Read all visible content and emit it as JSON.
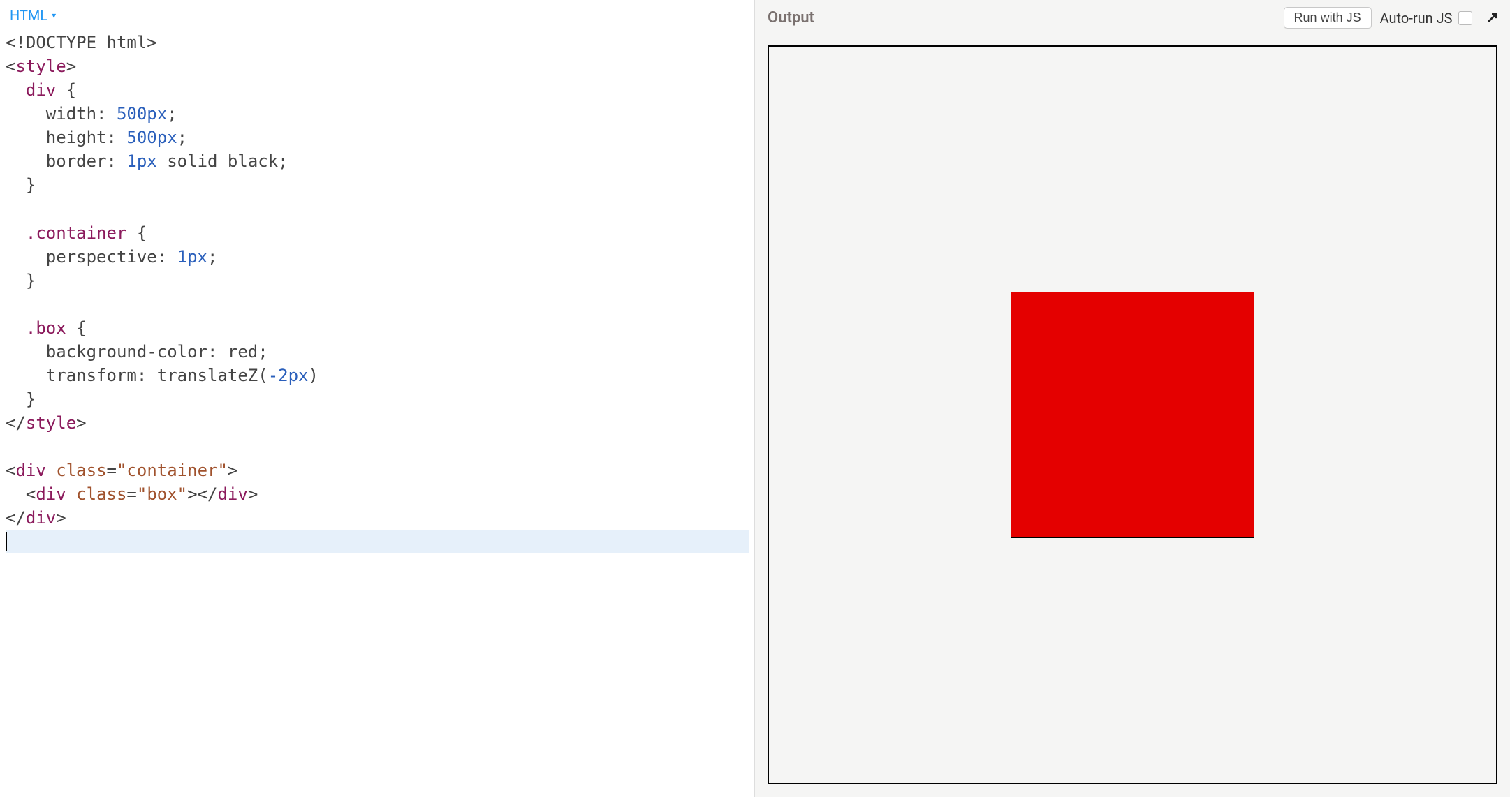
{
  "editor": {
    "language_label": "HTML",
    "code_lines": [
      {
        "html": "<span class='t-punct'>&lt;!</span><span class='t-doctype'>DOCTYPE html</span><span class='t-punct'>&gt;</span>"
      },
      {
        "html": "<span class='t-punct'>&lt;</span><span class='t-tag'>style</span><span class='t-punct'>&gt;</span>"
      },
      {
        "html": "  <span class='t-selector'>div</span> <span class='t-punct'>{</span>"
      },
      {
        "html": "    <span class='t-prop'>width</span><span class='t-punct'>:</span> <span class='t-num'>500px</span><span class='t-punct'>;</span>"
      },
      {
        "html": "    <span class='t-prop'>height</span><span class='t-punct'>:</span> <span class='t-num'>500px</span><span class='t-punct'>;</span>"
      },
      {
        "html": "    <span class='t-prop'>border</span><span class='t-punct'>:</span> <span class='t-num'>1px</span> <span class='t-kw'>solid</span> <span class='t-kw'>black</span><span class='t-punct'>;</span>"
      },
      {
        "html": "  <span class='t-punct'>}</span>"
      },
      {
        "html": ""
      },
      {
        "html": "  <span class='t-selector'>.container</span> <span class='t-punct'>{</span>"
      },
      {
        "html": "    <span class='t-prop'>perspective</span><span class='t-punct'>:</span> <span class='t-num'>1px</span><span class='t-punct'>;</span>"
      },
      {
        "html": "  <span class='t-punct'>}</span>"
      },
      {
        "html": ""
      },
      {
        "html": "  <span class='t-selector'>.box</span> <span class='t-punct'>{</span>"
      },
      {
        "html": "    <span class='t-prop'>background-color</span><span class='t-punct'>:</span> <span class='t-kw'>red</span><span class='t-punct'>;</span>"
      },
      {
        "html": "    <span class='t-prop'>transform</span><span class='t-punct'>:</span> <span class='t-kw'>translateZ</span><span class='t-punct'>(</span><span class='t-neg'>-2px</span><span class='t-punct'>)</span>"
      },
      {
        "html": "  <span class='t-punct'>}</span>"
      },
      {
        "html": "<span class='t-punct'>&lt;/</span><span class='t-tag'>style</span><span class='t-punct'>&gt;</span>"
      },
      {
        "html": ""
      },
      {
        "html": "<span class='t-punct'>&lt;</span><span class='t-tag'>div</span> <span class='t-attr'>class</span><span class='t-punct'>=</span><span class='t-string'>\"container\"</span><span class='t-punct'>&gt;</span>"
      },
      {
        "html": "  <span class='t-punct'>&lt;</span><span class='t-tag'>div</span> <span class='t-attr'>class</span><span class='t-punct'>=</span><span class='t-string'>\"box\"</span><span class='t-punct'>&gt;&lt;/</span><span class='t-tag'>div</span><span class='t-punct'>&gt;</span>"
      },
      {
        "html": "<span class='t-punct'>&lt;/</span><span class='t-tag'>div</span><span class='t-punct'>&gt;</span>"
      },
      {
        "html": "",
        "highlighted": true,
        "cursor": true
      }
    ],
    "raw_source": "<!DOCTYPE html>\n<style>\n  div {\n    width: 500px;\n    height: 500px;\n    border: 1px solid black;\n  }\n\n  .container {\n    perspective: 1px;\n  }\n\n  .box {\n    background-color: red;\n    transform: translateZ(-2px)\n  }\n</style>\n\n<div class=\"container\">\n  <div class=\"box\"></div>\n</div>\n"
  },
  "output": {
    "title": "Output",
    "run_button": "Run with JS",
    "auto_run_label": "Auto-run JS",
    "auto_run_checked": false
  }
}
